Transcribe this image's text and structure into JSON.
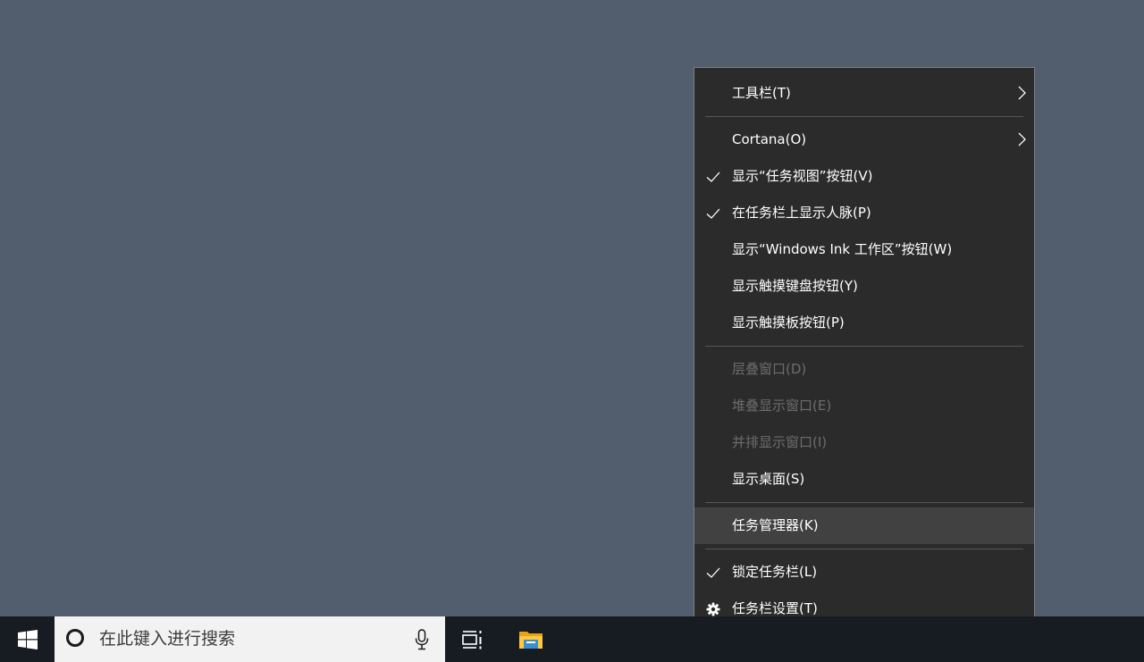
{
  "desktop": {
    "background_color": "#525e6d"
  },
  "taskbar": {
    "search": {
      "placeholder": "在此键入进行搜索"
    },
    "icons": {
      "start": "windows-logo-icon",
      "cortana": "cortana-ring-icon",
      "mic": "microphone-icon",
      "task_view": "task-view-icon",
      "file_explorer": "file-explorer-folder-icon"
    }
  },
  "context_menu": {
    "sections": [
      {
        "items": [
          {
            "label": "工具栏(T)",
            "submenu": true,
            "checked": false,
            "disabled": false
          }
        ]
      },
      {
        "items": [
          {
            "label": "Cortana(O)",
            "submenu": true,
            "checked": false,
            "disabled": false
          },
          {
            "label": "显示“任务视图”按钮(V)",
            "submenu": false,
            "checked": true,
            "disabled": false
          },
          {
            "label": "在任务栏上显示人脉(P)",
            "submenu": false,
            "checked": true,
            "disabled": false
          },
          {
            "label": "显示“Windows Ink 工作区”按钮(W)",
            "submenu": false,
            "checked": false,
            "disabled": false
          },
          {
            "label": "显示触摸键盘按钮(Y)",
            "submenu": false,
            "checked": false,
            "disabled": false
          },
          {
            "label": "显示触摸板按钮(P)",
            "submenu": false,
            "checked": false,
            "disabled": false
          }
        ]
      },
      {
        "items": [
          {
            "label": "层叠窗口(D)",
            "submenu": false,
            "checked": false,
            "disabled": true
          },
          {
            "label": "堆叠显示窗口(E)",
            "submenu": false,
            "checked": false,
            "disabled": true
          },
          {
            "label": "并排显示窗口(I)",
            "submenu": false,
            "checked": false,
            "disabled": true
          },
          {
            "label": "显示桌面(S)",
            "submenu": false,
            "checked": false,
            "disabled": false
          }
        ]
      },
      {
        "items": [
          {
            "label": "任务管理器(K)",
            "submenu": false,
            "checked": false,
            "disabled": false,
            "highlighted": true
          }
        ]
      },
      {
        "items": [
          {
            "label": "锁定任务栏(L)",
            "submenu": false,
            "checked": true,
            "disabled": false
          },
          {
            "label": "任务栏设置(T)",
            "submenu": false,
            "checked": false,
            "disabled": false,
            "icon": "gear-icon"
          }
        ]
      }
    ],
    "colors": {
      "background": "#2b2b2b",
      "border": "#808080",
      "text": "#ffffff",
      "disabled_text": "#6d6d6d",
      "highlight": "#414141",
      "separator": "#575757"
    }
  }
}
